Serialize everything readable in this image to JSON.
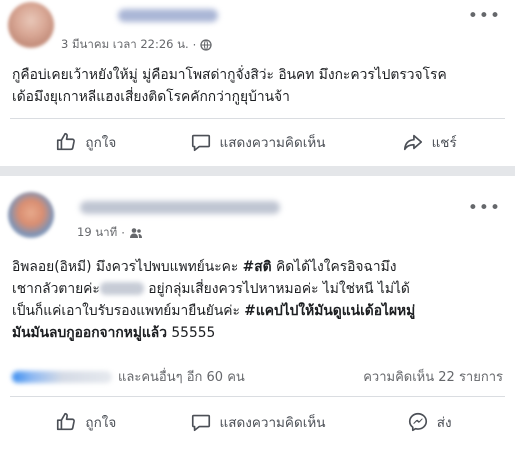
{
  "post1": {
    "author_name": "",
    "timestamp": "3 มีนาคม เวลา 22:26 น.",
    "separator": "·",
    "more_icon": "more-dots-icon",
    "body_lines": [
      "กูคือบ่เคยเว้าหยังให้มู่ มู่คือมาโพสด่ากูจั่งสิว่ะ อินคท มึงกะควรไปตรวจโรค",
      "เด้อมึงยุเกาหลีแฮงเสี่ยงติดโรคคักกว่ากูยุบ้านจ้า"
    ],
    "actions": {
      "like_label": "ถูกใจ",
      "comment_label": "แสดงความคิดเห็น",
      "share_label": "แชร์"
    }
  },
  "post2": {
    "author_name": "",
    "timestamp": "19 นาที",
    "separator": "·",
    "more_icon": "more-dots-icon",
    "body": {
      "line1_a": "อิพลอย(อิหมี) มึงควรไปพบแพทย์นะคะ ",
      "line1_tag": "#สติ",
      "line1_b": " คิดได้ไงใครอิจฉามึง",
      "line2_a": "เชากลัวตายค่ะ",
      "line2_b": " อยู่กลุ่มเสี่ยงควรไปหาหมอค่ะ ไม่ใช่หนี ไม่ได้",
      "line3_a": "เป็นก็แค่เอาใบรับรองแพทย์มายืนยันค่ะ ",
      "line3_tag": "#แคปไปให้มันดูแน่เด้อไผหมู่",
      "line4_a": "มันมันลบกูออกจากหมู่แล้ว",
      "line4_b": " 55555"
    },
    "stats": {
      "reactions_text": "และคนอื่นๆ อีก 60 คน",
      "comments_text": "ความคิดเห็น 22 รายการ"
    },
    "actions": {
      "like_label": "ถูกใจ",
      "comment_label": "แสดงความคิดเห็น",
      "send_label": "ส่ง"
    }
  },
  "colors": {
    "background": "#e4e6e9",
    "card": "#ffffff",
    "text": "#1c1e21",
    "secondary_text": "#65676b",
    "action_text": "#4b4f56"
  }
}
